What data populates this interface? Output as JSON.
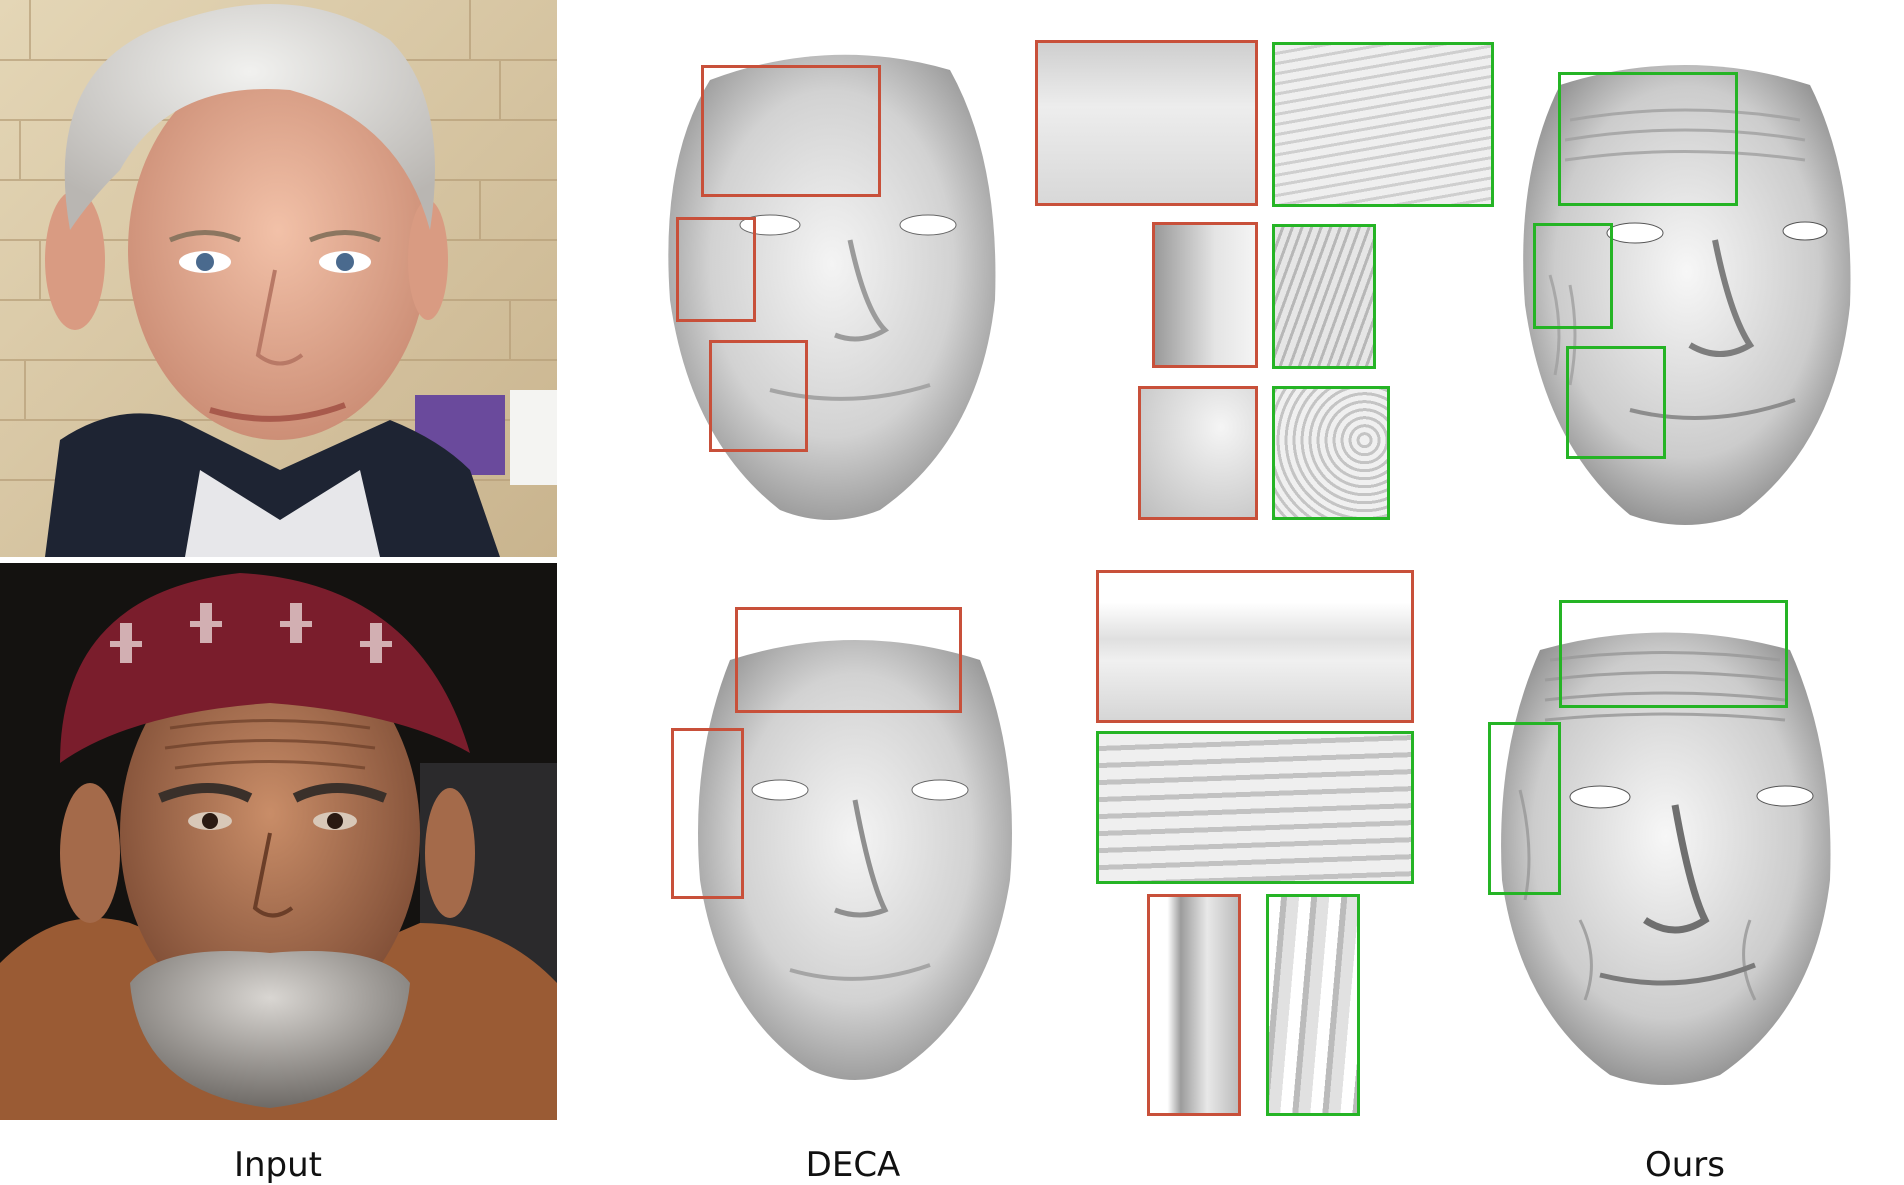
{
  "figure": {
    "captions": {
      "input": "Input",
      "deca": "DECA",
      "ours": "Ours"
    },
    "colors": {
      "deca_box": "#c8503a",
      "ours_box": "#25b425",
      "background": "#ffffff"
    },
    "rows": [
      {
        "subject": "photo-man-gray-hair",
        "deca_crops": 3,
        "ours_crops": 3
      },
      {
        "subject": "photo-elderly-man-knit-cap",
        "deca_crops": 2,
        "ours_crops": 2
      }
    ]
  }
}
